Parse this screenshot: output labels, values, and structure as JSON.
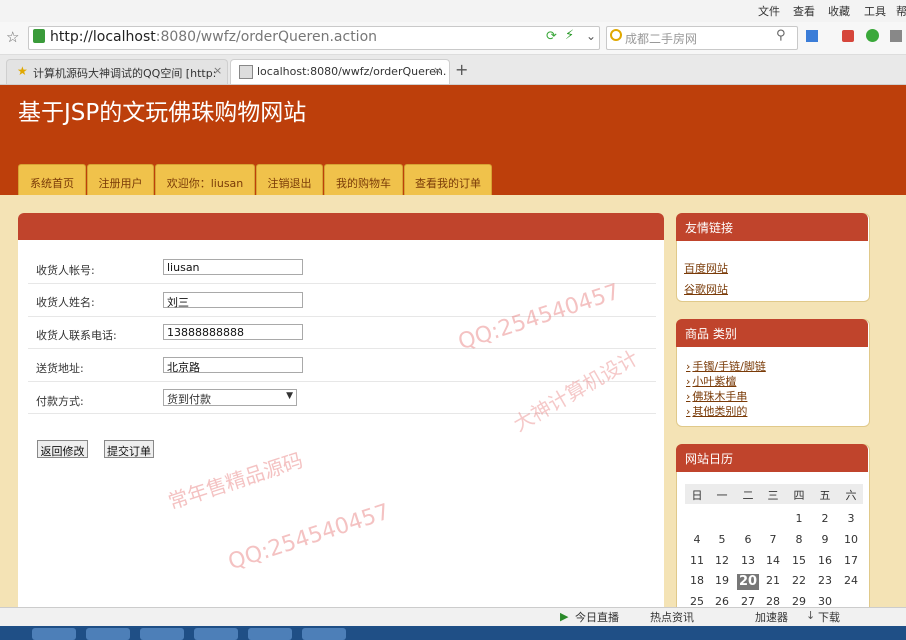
{
  "browser": {
    "menu": [
      "文件",
      "查看",
      "收藏",
      "工具",
      "帮"
    ],
    "url_host": "http://localhost",
    "url_rest": ":8080/wwfz/orderQueren.action",
    "search_placeholder": "成都二手房网",
    "tabs": [
      {
        "label": "计算机源码大神调试的QQ空间 [http:"
      },
      {
        "label": "localhost:8080/wwfz/orderQueren."
      }
    ],
    "new_tab": "+"
  },
  "site": {
    "title": "基于JSP的文玩佛珠购物网站",
    "nav": [
      "系统首页",
      "注册用户",
      "欢迎你：liusan",
      "注销退出",
      "我的购物车",
      "查看我的订单"
    ]
  },
  "form": {
    "fields": [
      {
        "label": "收货人帐号:",
        "value": "liusan"
      },
      {
        "label": "收货人姓名:",
        "value": "刘三"
      },
      {
        "label": "收货人联系电话:",
        "value": "13888888888"
      },
      {
        "label": "送货地址:",
        "value": "北京路"
      }
    ],
    "payment_label": "付款方式:",
    "payment_value": "货到付款",
    "back_button": "返回修改",
    "submit_button": "提交订单"
  },
  "sidebar": {
    "friends_title": "友情链接",
    "friends": [
      "百度网站",
      "谷歌网站"
    ],
    "category_title": "商品 类别",
    "categories": [
      "手镯/手链/脚链",
      "小叶紫檀",
      "佛珠木手串",
      "其他类别的"
    ],
    "calendar_title": "网站日历",
    "weekdays": [
      "日",
      "一",
      "二",
      "三",
      "四",
      "五",
      "六"
    ],
    "calendar_rows": [
      [
        "",
        "",
        "",
        "",
        "1",
        "2",
        "3"
      ],
      [
        "4",
        "5",
        "6",
        "7",
        "8",
        "9",
        "10"
      ],
      [
        "11",
        "12",
        "13",
        "14",
        "15",
        "16",
        "17"
      ],
      [
        "18",
        "19",
        "20",
        "21",
        "22",
        "23",
        "24"
      ],
      [
        "25",
        "26",
        "27",
        "28",
        "29",
        "30",
        ""
      ]
    ],
    "today": "20"
  },
  "statusbar": [
    "今日直播",
    "热点资讯",
    "加速器",
    "下载"
  ],
  "watermarks": [
    "QQ:254540457",
    "常年售精品源码",
    "大神计算机设计"
  ],
  "colors": {
    "header": "#bd3f0b",
    "nav": "#f0c24b",
    "panel_head": "#c0442c",
    "page_bg": "#f4e3b5"
  }
}
